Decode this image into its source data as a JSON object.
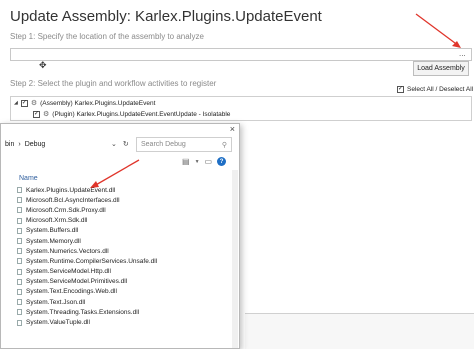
{
  "window": {
    "title": "Update Assembly: Karlex.Plugins.UpdateEvent",
    "step1_label": "Step 1: Specify the location of the assembly to analyze",
    "path_value": "",
    "browse_label": "...",
    "load_button": "Load Assembly",
    "step2_label": "Step 2: Select the plugin and workflow activities to register",
    "select_all_label": "Select All / Deselect All"
  },
  "tree": {
    "rows": [
      {
        "label": "(Assembly) Karlex.Plugins.UpdateEvent"
      },
      {
        "label": "(Plugin) Karlex.Plugins.UpdateEvent.EventUpdate - Isolatable"
      }
    ]
  },
  "dialog": {
    "close": "×",
    "breadcrumb": [
      "bin",
      "›",
      "Debug"
    ],
    "search_placeholder": "Search Debug",
    "column_name": "Name",
    "files": [
      "Karlex.Plugins.UpdateEvent.dll",
      "Microsoft.Bcl.AsyncInterfaces.dll",
      "Microsoft.Crm.Sdk.Proxy.dll",
      "Microsoft.Xrm.Sdk.dll",
      "System.Buffers.dll",
      "System.Memory.dll",
      "System.Numerics.Vectors.dll",
      "System.Runtime.CompilerServices.Unsafe.dll",
      "System.ServiceModel.Http.dll",
      "System.ServiceModel.Primitives.dll",
      "System.Text.Encodings.Web.dll",
      "System.Text.Json.dll",
      "System.Threading.Tasks.Extensions.dll",
      "System.ValueTuple.dll"
    ]
  },
  "colors": {
    "accent": "#1f6fc5",
    "arrow": "#e0352b",
    "link": "#2f5f9e"
  }
}
